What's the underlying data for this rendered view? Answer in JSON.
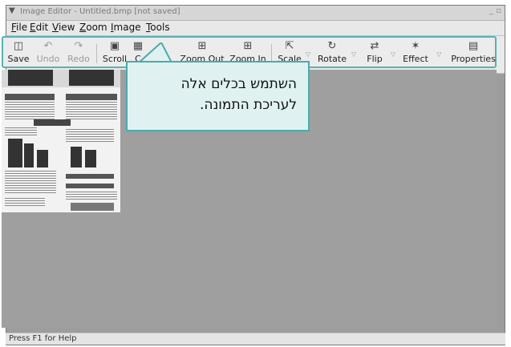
{
  "window": {
    "title": "Image Editor - Untitled.bmp [not saved]",
    "controls": "_ ▫"
  },
  "menu": [
    "File",
    "Edit",
    "View",
    "Zoom",
    "Image",
    "Tools"
  ],
  "toolbar": {
    "save": {
      "label": "Save",
      "icon": "floppy-disk-icon",
      "enabled": true
    },
    "undo": {
      "label": "Undo",
      "icon": "undo-icon",
      "enabled": false
    },
    "redo": {
      "label": "Redo",
      "icon": "redo-icon",
      "enabled": false
    },
    "scroll": {
      "label": "Scroll",
      "icon": "scroll-icon",
      "enabled": true
    },
    "crop": {
      "label": "C",
      "icon": "crop-icon",
      "enabled": true
    },
    "zoom_out": {
      "label": "Zoom Out",
      "icon": "zoom-out-icon",
      "enabled": true
    },
    "zoom_in": {
      "label": "Zoom In",
      "icon": "zoom-in-icon",
      "enabled": true
    },
    "scale": {
      "label": "Scale",
      "icon": "scale-icon",
      "enabled": true
    },
    "rotate": {
      "label": "Rotate",
      "icon": "rotate-icon",
      "enabled": true
    },
    "flip": {
      "label": "Flip",
      "icon": "flip-icon",
      "enabled": true
    },
    "effect": {
      "label": "Effect",
      "icon": "effect-icon",
      "enabled": true
    },
    "properties": {
      "label": "Properties",
      "icon": "properties-icon",
      "enabled": true
    }
  },
  "callout": {
    "line1": "השתמש בכלים אלה",
    "line2": "לעריכת התמונה."
  },
  "status": "Press F1 for Help",
  "colors": {
    "accent": "#58b1b3",
    "callout_bg": "#dff2f1",
    "canvas": "#9f9f9f"
  }
}
